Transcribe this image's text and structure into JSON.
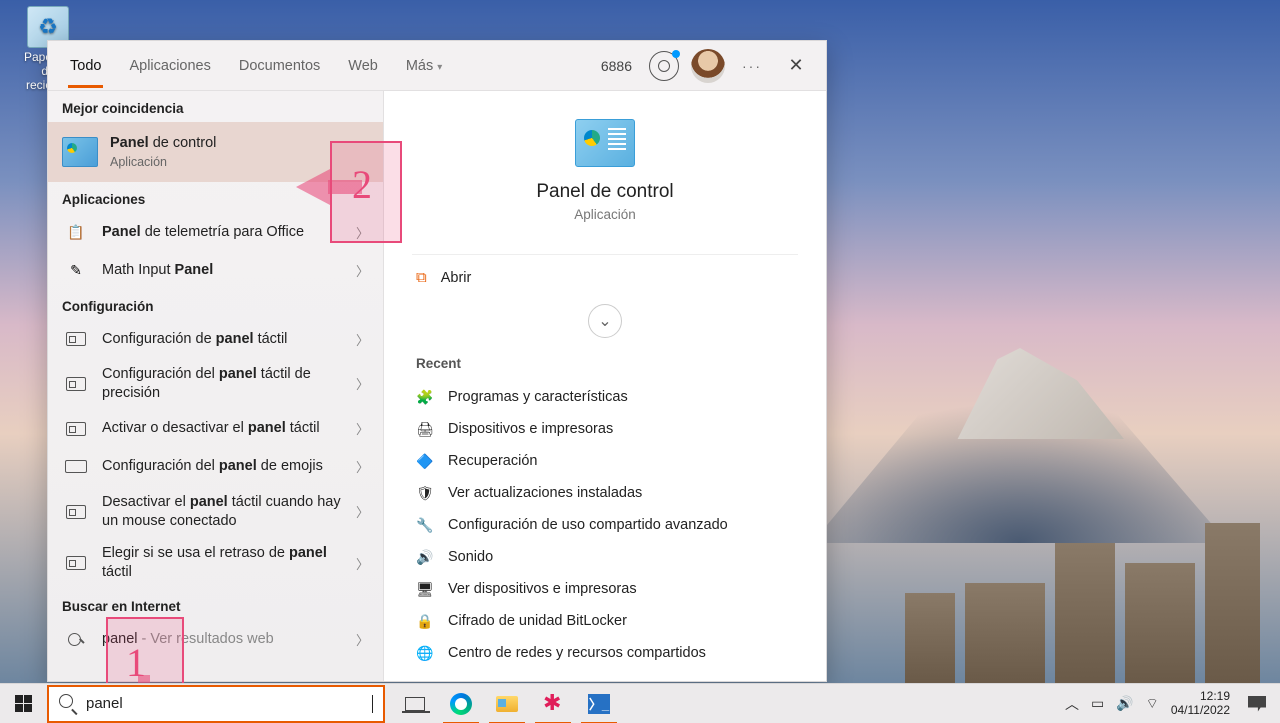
{
  "desktop": {
    "recycle_label": "Papelera de reciclaje"
  },
  "search": {
    "tabs": {
      "all": "Todo",
      "apps": "Aplicaciones",
      "docs": "Documentos",
      "web": "Web",
      "more": "Más"
    },
    "reward_points": "6886",
    "sections": {
      "best": "Mejor coincidencia",
      "apps": "Aplicaciones",
      "settings": "Configuración",
      "web": "Buscar en Internet"
    },
    "best": {
      "title_pre": "Panel",
      "title_rest": " de control",
      "sub": "Aplicación"
    },
    "apps_list": [
      {
        "pre": "Panel",
        "rest": " de telemetría para Office"
      },
      {
        "pre_plain": "Math Input ",
        "bold": "Panel"
      }
    ],
    "settings_list": [
      {
        "t": "Configuración de <b>panel</b> táctil"
      },
      {
        "t": "Configuración del <b>panel</b> táctil de precisión"
      },
      {
        "t": "Activar o desactivar el <b>panel</b> táctil"
      },
      {
        "t": "Configuración del <b>panel</b> de emojis"
      },
      {
        "t": "Desactivar el <b>panel</b> táctil cuando hay un mouse conectado"
      },
      {
        "t": "Elegir si se usa el retraso de <b>panel</b> táctil"
      }
    ],
    "web_item": {
      "term": "panel",
      "hint": " - Ver resultados web"
    },
    "detail": {
      "title": "Panel de control",
      "sub": "Aplicación",
      "open": "Abrir",
      "expand_glyph": "⌄",
      "recent_head": "Recent",
      "recent": [
        "Programas y características",
        "Dispositivos e impresoras",
        "Recuperación",
        "Ver actualizaciones instaladas",
        "Configuración de uso compartido avanzado",
        "Sonido",
        "Ver dispositivos e impresoras",
        "Cifrado de unidad BitLocker",
        "Centro de redes y recursos compartidos"
      ]
    }
  },
  "annotations": {
    "one": "1",
    "two": "2"
  },
  "taskbar": {
    "search_value": "panel",
    "clock_time": "12:19",
    "clock_date": "04/11/2022",
    "tray_up": "︿"
  }
}
